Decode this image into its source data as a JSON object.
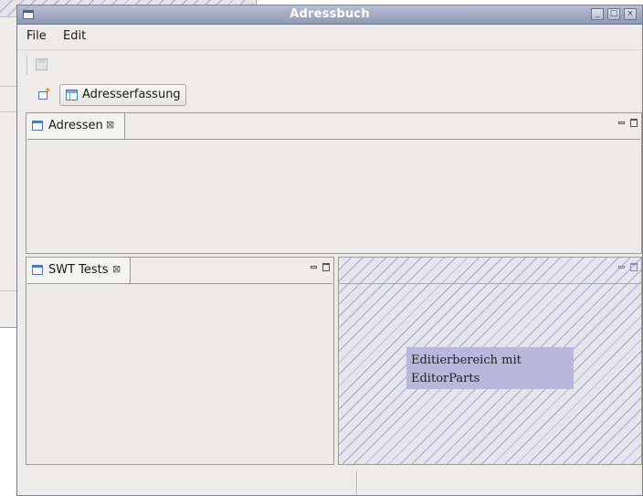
{
  "window": {
    "title": "Adressbuch"
  },
  "menu": {
    "file": "File",
    "edit": "Edit"
  },
  "perspective": {
    "label": "Adresserfassung"
  },
  "views": {
    "adressen": {
      "label": "Adressen"
    },
    "swt_tests": {
      "label": "SWT Tests"
    }
  },
  "editor": {
    "note_line1": "Editierbereich mit",
    "note_line2": "EditorParts"
  },
  "icons": {
    "close_tab": "⊠",
    "window_min": "_",
    "window_max": "□",
    "window_close": "×"
  },
  "colors": {
    "titlebar": "#9aa3bd",
    "editor_hatch": "#a9a8c4",
    "editor_note": "#b9b7dc"
  }
}
